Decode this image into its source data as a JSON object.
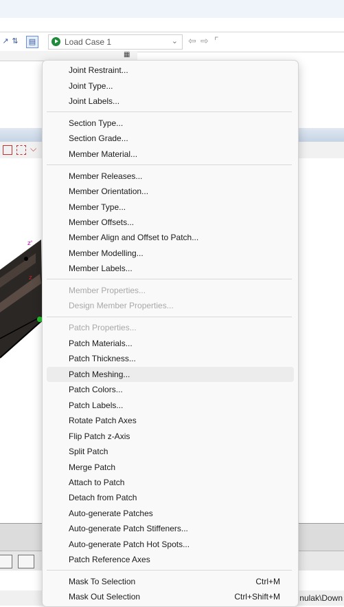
{
  "toolbar": {
    "load_case": "Load Case 1"
  },
  "status": {
    "path_text": "nulak\\Down"
  },
  "colors": {
    "highlight": "#ececec",
    "disabled_text": "#a8a8a8",
    "play": "#1f8a3a"
  },
  "menu": {
    "groups": [
      [
        "Joint Restraint...",
        "Joint Type...",
        "Joint Labels..."
      ],
      [
        "Section Type...",
        "Section Grade...",
        "Member Material..."
      ],
      [
        "Member Releases...",
        "Member Orientation...",
        "Member Type...",
        "Member Offsets...",
        "Member Align and Offset to Patch...",
        "Member Modelling...",
        "Member Labels..."
      ],
      [
        "Member Properties...",
        "Design Member Properties..."
      ],
      [
        "Patch Properties...",
        "Patch Materials...",
        "Patch Thickness...",
        "Patch Meshing...",
        "Patch Colors...",
        "Patch Labels...",
        "Rotate Patch Axes",
        "Flip Patch z-Axis",
        "Split Patch",
        "Merge Patch",
        "Attach to Patch",
        "Detach from Patch",
        "Auto-generate Patches",
        "Auto-generate Patch Stiffeners...",
        "Auto-generate Patch Hot Spots...",
        "Patch Reference Axes"
      ],
      [
        "Mask To Selection",
        "Mask Out Selection"
      ]
    ],
    "items": [
      {
        "label": "Joint Restraint..."
      },
      {
        "label": "Joint Type..."
      },
      {
        "label": "Joint Labels..."
      },
      {
        "label": "Section Type..."
      },
      {
        "label": "Section Grade..."
      },
      {
        "label": "Member Material..."
      },
      {
        "label": "Member Releases..."
      },
      {
        "label": "Member Orientation..."
      },
      {
        "label": "Member Type..."
      },
      {
        "label": "Member Offsets..."
      },
      {
        "label": "Member Align and Offset to Patch..."
      },
      {
        "label": "Member Modelling..."
      },
      {
        "label": "Member Labels..."
      },
      {
        "label": "Member Properties...",
        "disabled": true
      },
      {
        "label": "Design Member Properties...",
        "disabled": true
      },
      {
        "label": "Patch Properties...",
        "disabled": true
      },
      {
        "label": "Patch Materials..."
      },
      {
        "label": "Patch Thickness..."
      },
      {
        "label": "Patch Meshing...",
        "highlighted": true
      },
      {
        "label": "Patch Colors..."
      },
      {
        "label": "Patch Labels..."
      },
      {
        "label": "Rotate Patch Axes"
      },
      {
        "label": "Flip Patch z-Axis"
      },
      {
        "label": "Split Patch"
      },
      {
        "label": "Merge Patch"
      },
      {
        "label": "Attach to Patch"
      },
      {
        "label": "Detach from Patch"
      },
      {
        "label": "Auto-generate Patches"
      },
      {
        "label": "Auto-generate Patch Stiffeners..."
      },
      {
        "label": "Auto-generate Patch Hot Spots..."
      },
      {
        "label": "Patch Reference Axes"
      },
      {
        "label": "Mask To Selection",
        "shortcut": "Ctrl+M"
      },
      {
        "label": "Mask Out Selection",
        "shortcut": "Ctrl+Shift+M"
      }
    ]
  }
}
